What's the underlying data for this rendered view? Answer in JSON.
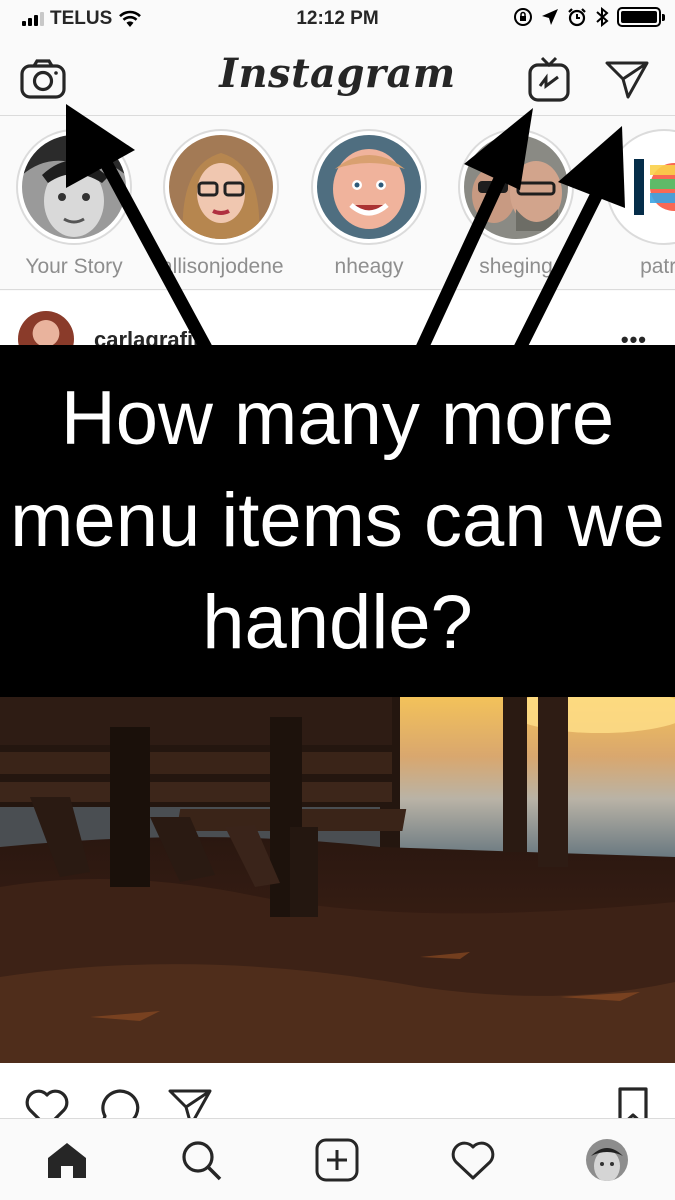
{
  "status_bar": {
    "carrier": "TELUS",
    "time": "12:12 PM",
    "icons": [
      "signal-icon",
      "wifi-icon",
      "lock-rotation-icon",
      "location-icon",
      "alarm-icon",
      "bluetooth-icon",
      "battery-icon"
    ]
  },
  "header": {
    "logo": "Instagram",
    "icons": [
      "camera-icon",
      "igtv-icon",
      "direct-message-icon"
    ]
  },
  "stories": [
    {
      "name": "Your Story"
    },
    {
      "name": "allisonjodene"
    },
    {
      "name": "nheagy"
    },
    {
      "name": "sheging"
    },
    {
      "name": "patre"
    }
  ],
  "post": {
    "username": "carlagrafin",
    "more": "•••"
  },
  "overlay": {
    "caption": "How many more menu items can we handle?"
  },
  "actions": {
    "icons": [
      "like-icon",
      "comment-icon",
      "share-icon",
      "bookmark-icon"
    ]
  },
  "tabbar": {
    "icons": [
      "home-icon",
      "search-icon",
      "new-post-icon",
      "activity-icon",
      "profile-avatar-icon"
    ]
  },
  "colors": {
    "background": "#fafafa",
    "border": "#dbdbdb",
    "text": "#262626",
    "muted": "#8e8e8e",
    "overlay": "#000000"
  }
}
